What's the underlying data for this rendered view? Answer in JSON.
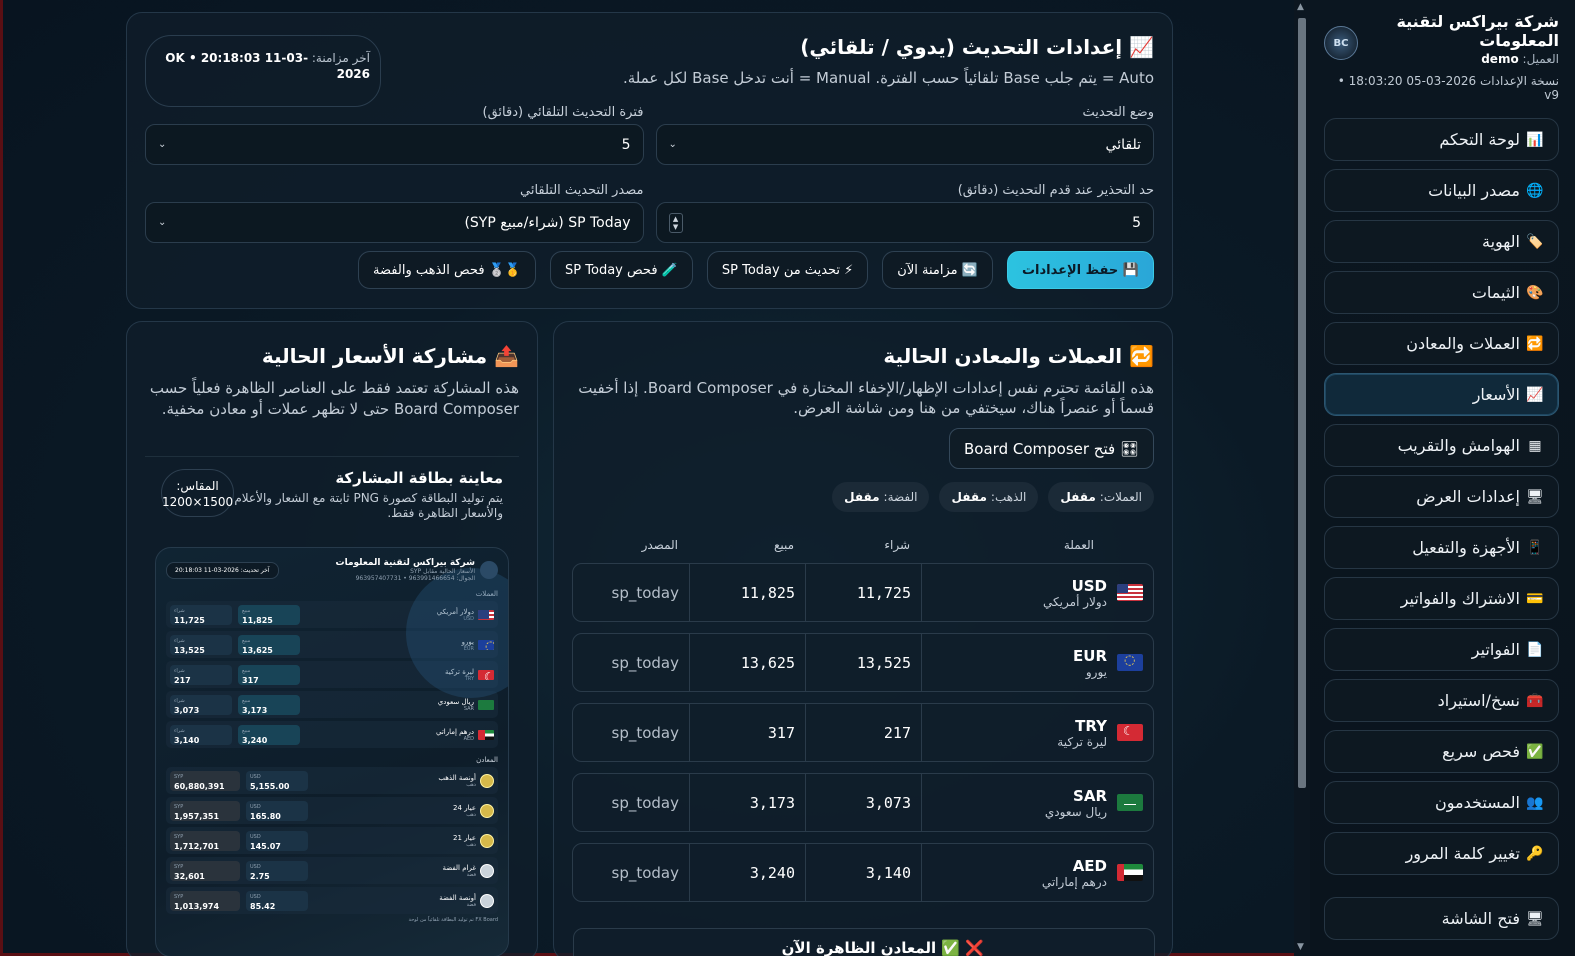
{
  "sidebar": {
    "brand_name": "شركة بيراكس لتقنية المعلومات",
    "client_label": "العميل:",
    "client_value": "demo",
    "version": "نسخة الإعدادات 2026-03-05 18:03:20 • v9",
    "logo_text": "BC",
    "items": [
      {
        "icon": "📊",
        "label": "لوحة التحكم"
      },
      {
        "icon": "🌐",
        "label": "مصدر البيانات"
      },
      {
        "icon": "🏷️",
        "label": "الهوية"
      },
      {
        "icon": "🎨",
        "label": "الثيمات"
      },
      {
        "icon": "🔁",
        "label": "العملات والمعادن"
      },
      {
        "icon": "📈",
        "label": "الأسعار"
      },
      {
        "icon": "▦",
        "label": "الهوامش والتقريب"
      },
      {
        "icon": "🖥",
        "label": "إعدادات العرض"
      },
      {
        "icon": "📱",
        "label": "الأجهزة والتفعيل"
      },
      {
        "icon": "💳",
        "label": "الاشتراك والفواتير"
      },
      {
        "icon": "📄",
        "label": "الفواتير"
      },
      {
        "icon": "🧰",
        "label": "نسخ/استيراد"
      },
      {
        "icon": "✅",
        "label": "فحص سريع"
      },
      {
        "icon": "👥",
        "label": "المستخدمون"
      },
      {
        "icon": "🔑",
        "label": "تغيير كلمة المرور"
      }
    ],
    "bottom_item": {
      "icon": "🖥",
      "label": "فتح الشاشة"
    }
  },
  "settings": {
    "title": "📈 إعدادات التحديث (يدوي / تلقائي)",
    "description": "Auto = يتم جلب Base تلقائياً حسب الفترة. Manual = أنت تدخل Base لكل عملة.",
    "sync_label": "آخر مزامنة:",
    "sync_value": "OK • 20:18:03 11-03-2026",
    "fields": {
      "mode_label": "وضع التحديث",
      "mode_value": "تلقائي",
      "interval_label": "فترة التحديث التلقائي (دقائق)",
      "interval_value": "5",
      "warn_label": "حد التحذير عند قدم التحديث (دقائق)",
      "warn_value": "5",
      "source_label": "مصدر التحديث التلقائي",
      "source_value": "SP Today (شراء/مبيع SYP)"
    },
    "buttons": {
      "save": "💾 حفظ الإعدادات",
      "sync": "🔄 مزامنة الآن",
      "update_sp": "⚡ تحديث من SP Today",
      "check_sp": "🧪 فحص SP Today",
      "check_metals": "🥇🥈 فحص الذهب والفضة"
    }
  },
  "currencies": {
    "title": "🔁 العملات والمعادن الحالية",
    "description": "هذه القائمة تحترم نفس إعدادات الإظهار/الإخفاء المختارة في Board Composer. إذا أخفيت قسماً أو عنصراً هناك، سيختفي من هنا ومن شاشة العرض.",
    "composer_button": "🎛 فتح Board Composer",
    "chips": [
      {
        "label": "العملات:",
        "value": "مقفل"
      },
      {
        "label": "الذهب:",
        "value": "مقفل"
      },
      {
        "label": "الفضة:",
        "value": "مقفل"
      }
    ],
    "headers": [
      "العملة",
      "شراء",
      "مبيع",
      "المصدر"
    ],
    "rows": [
      {
        "flag": "us",
        "code": "USD",
        "name": "دولار أمريكي",
        "buy": "11,725",
        "sell": "11,825",
        "source": "sp_today"
      },
      {
        "flag": "eu",
        "code": "EUR",
        "name": "يورو",
        "buy": "13,525",
        "sell": "13,625",
        "source": "sp_today"
      },
      {
        "flag": "tr",
        "code": "TRY",
        "name": "ليرة تركية",
        "buy": "217",
        "sell": "317",
        "source": "sp_today"
      },
      {
        "flag": "sa",
        "code": "SAR",
        "name": "ريال سعودي",
        "buy": "3,073",
        "sell": "3,173",
        "source": "sp_today"
      },
      {
        "flag": "ae",
        "code": "AED",
        "name": "درهم إماراتي",
        "buy": "3,140",
        "sell": "3,240",
        "source": "sp_today"
      }
    ],
    "next_section": "❌ ✅ المعادن الظاهرة الآن"
  },
  "share": {
    "title": "📤 مشاركة الأسعار الحالية",
    "description": "هذه المشاركة تعتمد فقط على العناصر الظاهرة فعلياً حسب Board Composer حتى لا تظهر عملات أو معادن مخفية.",
    "preview_title": "معاينة بطاقة المشاركة",
    "preview_sub": "يتم توليد البطاقة كصورة PNG ثابتة مع الشعار والأعلام والأسعار الظاهرة فقط.",
    "scale_label": "المقاس:",
    "scale_value": "1500×1200",
    "thumb": {
      "brand": "شركة بيراكس لتقنية المعلومات",
      "brand_sub": "الأسعار الحالية مقابل SYP",
      "phones": "الجوال: 963991466654 • 963957407731",
      "date": "آخر تحديث: 2026-03-11 20:18:03",
      "currencies_label": "العملات",
      "metals_label": "المعادن",
      "buy_label": "شراء",
      "sell_label": "مبيع",
      "cur_rows": [
        {
          "flag": "us",
          "name": "دولار أمريكي",
          "code": "USD",
          "buy": "11,725",
          "sell": "11,825"
        },
        {
          "flag": "eu",
          "name": "يورو",
          "code": "EUR",
          "buy": "13,525",
          "sell": "13,625"
        },
        {
          "flag": "tr",
          "name": "ليرة تركية",
          "code": "TRY",
          "buy": "217",
          "sell": "317"
        },
        {
          "flag": "sa",
          "name": "ريال سعودي",
          "code": "SAR",
          "buy": "3,073",
          "sell": "3,173"
        },
        {
          "flag": "ae",
          "name": "درهم إماراتي",
          "code": "AED",
          "buy": "3,140",
          "sell": "3,240"
        }
      ],
      "metal_rows": [
        {
          "coin": "gold",
          "name": "أونصة الذهب",
          "sub": "ذهب",
          "syp": "60,880,391",
          "usd": "5,155.00"
        },
        {
          "coin": "gold",
          "name": "عيار 24",
          "sub": "ذهب",
          "syp": "1,957,351",
          "usd": "165.80"
        },
        {
          "coin": "gold",
          "name": "عيار 21",
          "sub": "ذهب",
          "syp": "1,712,701",
          "usd": "145.07"
        },
        {
          "coin": "silver",
          "name": "غرام الفضة",
          "sub": "فضة",
          "syp": "32,601",
          "usd": "2.75"
        },
        {
          "coin": "silver",
          "name": "أونصة الفضة",
          "sub": "فضة",
          "syp": "1,013,974",
          "usd": "85.42"
        }
      ],
      "syp_label": "SYP",
      "usd_label": "USD",
      "footer": "FX Board تم توليد البطاقة تلقائياً من لوحة"
    }
  },
  "colors": {
    "accent": "#2cc3e0",
    "background": "#0b1a26",
    "frame": "#5a0f14"
  }
}
